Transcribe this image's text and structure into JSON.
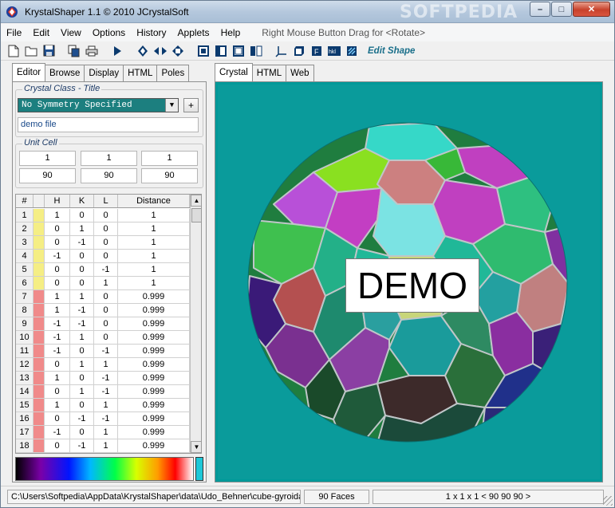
{
  "window": {
    "title": "KrystalShaper 1.1   © 2010 JCrystalSoft",
    "watermark": "SOFTPEDIA",
    "minimize_label": "–",
    "maximize_label": "□",
    "close_label": "✕"
  },
  "menu": {
    "items": [
      "File",
      "Edit",
      "View",
      "Options",
      "History",
      "Applets",
      "Help"
    ],
    "hint": "Right Mouse Button Drag for <Rotate>"
  },
  "toolbar": {
    "icons": [
      "new-file-icon",
      "open-folder-icon",
      "save-icon",
      "copy-icon",
      "print-icon",
      "play-icon",
      "rotate-up-icon",
      "rotate-horizontal-icon",
      "rotate-center-icon",
      "view-front-icon",
      "view-side-icon",
      "view-top-icon",
      "view-all-icon",
      "axes-icon",
      "cube-icon",
      "face-f-icon",
      "hkl-icon",
      "texture-icon"
    ],
    "edit_shape_label": "Edit Shape"
  },
  "left_tabs": [
    "Editor",
    "Browse",
    "Display",
    "HTML",
    "Poles"
  ],
  "right_tabs": [
    "Crystal",
    "HTML",
    "Web"
  ],
  "crystal_class": {
    "group_label": "Crystal Class - Title",
    "selected": "No Symmetry Specified",
    "add_label": "+",
    "title_value": "demo file"
  },
  "unit_cell": {
    "group_label": "Unit Cell",
    "lengths": [
      "1",
      "1",
      "1"
    ],
    "angles": [
      "90",
      "90",
      "90"
    ]
  },
  "table": {
    "headers": [
      "#",
      "",
      "H",
      "K",
      "L",
      "Distance"
    ],
    "rows": [
      {
        "n": "1",
        "color": "#f5ee84",
        "h": "1",
        "k": "0",
        "l": "0",
        "d": "1"
      },
      {
        "n": "2",
        "color": "#f5ee84",
        "h": "0",
        "k": "1",
        "l": "0",
        "d": "1"
      },
      {
        "n": "3",
        "color": "#f5ee84",
        "h": "0",
        "k": "-1",
        "l": "0",
        "d": "1"
      },
      {
        "n": "4",
        "color": "#f5ee84",
        "h": "-1",
        "k": "0",
        "l": "0",
        "d": "1"
      },
      {
        "n": "5",
        "color": "#f5ee84",
        "h": "0",
        "k": "0",
        "l": "-1",
        "d": "1"
      },
      {
        "n": "6",
        "color": "#f5ee84",
        "h": "0",
        "k": "0",
        "l": "1",
        "d": "1"
      },
      {
        "n": "7",
        "color": "#f08a8a",
        "h": "1",
        "k": "1",
        "l": "0",
        "d": "0.999"
      },
      {
        "n": "8",
        "color": "#f08a8a",
        "h": "1",
        "k": "-1",
        "l": "0",
        "d": "0.999"
      },
      {
        "n": "9",
        "color": "#f08a8a",
        "h": "-1",
        "k": "-1",
        "l": "0",
        "d": "0.999"
      },
      {
        "n": "10",
        "color": "#f08a8a",
        "h": "-1",
        "k": "1",
        "l": "0",
        "d": "0.999"
      },
      {
        "n": "11",
        "color": "#f08a8a",
        "h": "-1",
        "k": "0",
        "l": "-1",
        "d": "0.999"
      },
      {
        "n": "12",
        "color": "#f08a8a",
        "h": "0",
        "k": "1",
        "l": "1",
        "d": "0.999"
      },
      {
        "n": "13",
        "color": "#f08a8a",
        "h": "1",
        "k": "0",
        "l": "-1",
        "d": "0.999"
      },
      {
        "n": "14",
        "color": "#f08a8a",
        "h": "0",
        "k": "1",
        "l": "-1",
        "d": "0.999"
      },
      {
        "n": "15",
        "color": "#f08a8a",
        "h": "1",
        "k": "0",
        "l": "1",
        "d": "0.999"
      },
      {
        "n": "16",
        "color": "#f08a8a",
        "h": "0",
        "k": "-1",
        "l": "-1",
        "d": "0.999"
      },
      {
        "n": "17",
        "color": "#f08a8a",
        "h": "-1",
        "k": "0",
        "l": "1",
        "d": "0.999"
      },
      {
        "n": "18",
        "color": "#f08a8a",
        "h": "0",
        "k": "-1",
        "l": "1",
        "d": "0.999"
      }
    ]
  },
  "viewport": {
    "background_color": "#0a9b9b",
    "demo_label": "DEMO"
  },
  "status": {
    "path": "C:\\Users\\Softpedia\\AppData\\KrystalShaper\\data\\Udo_Behner\\cube-gyroidal",
    "faces": "90 Faces",
    "cell": "1 x 1 x 1 < 90 90 90 >"
  }
}
